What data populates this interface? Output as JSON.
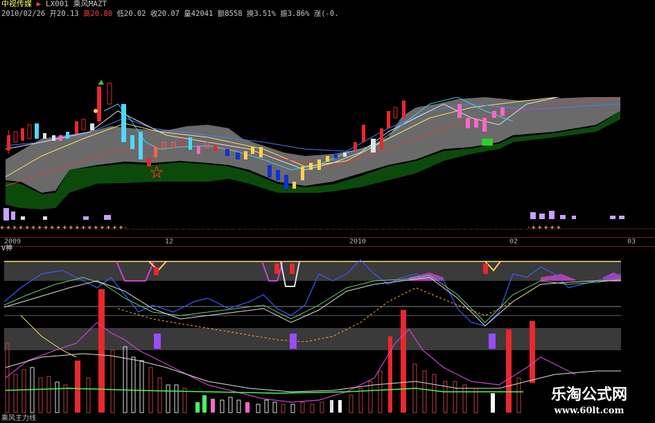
{
  "header": {
    "stock_name": "中视传媒",
    "stock_code": "LX001",
    "formula_name": "乘风MAZT",
    "date": "2010/02/26",
    "open": "开20.13",
    "high": "高20.80",
    "low": "低20.02",
    "close": "收20.07",
    "volume": "量42041",
    "amount": "额8558",
    "turnover": "换3.51%",
    "amplitude": "振3.86%",
    "extra": "涨(-0."
  },
  "axis": {
    "dates": [
      "2009",
      "12",
      "2010",
      "02",
      "03"
    ]
  },
  "indicator": {
    "name": "V神"
  },
  "bottom_indicator": {
    "name": "乘风主力线"
  },
  "watermark": {
    "title": "乐淘公式网",
    "url": "www.60lt.com"
  },
  "colors": {
    "up": "#e8282d",
    "down_cyan": "#4fd7ff",
    "down_blue": "#1030d8",
    "band_gray": "#6a6a6a",
    "band_green": "#0c4a0c",
    "magenta": "#cc44cc",
    "yellow": "#ffd24a",
    "purple": "#9a4cff"
  }
}
